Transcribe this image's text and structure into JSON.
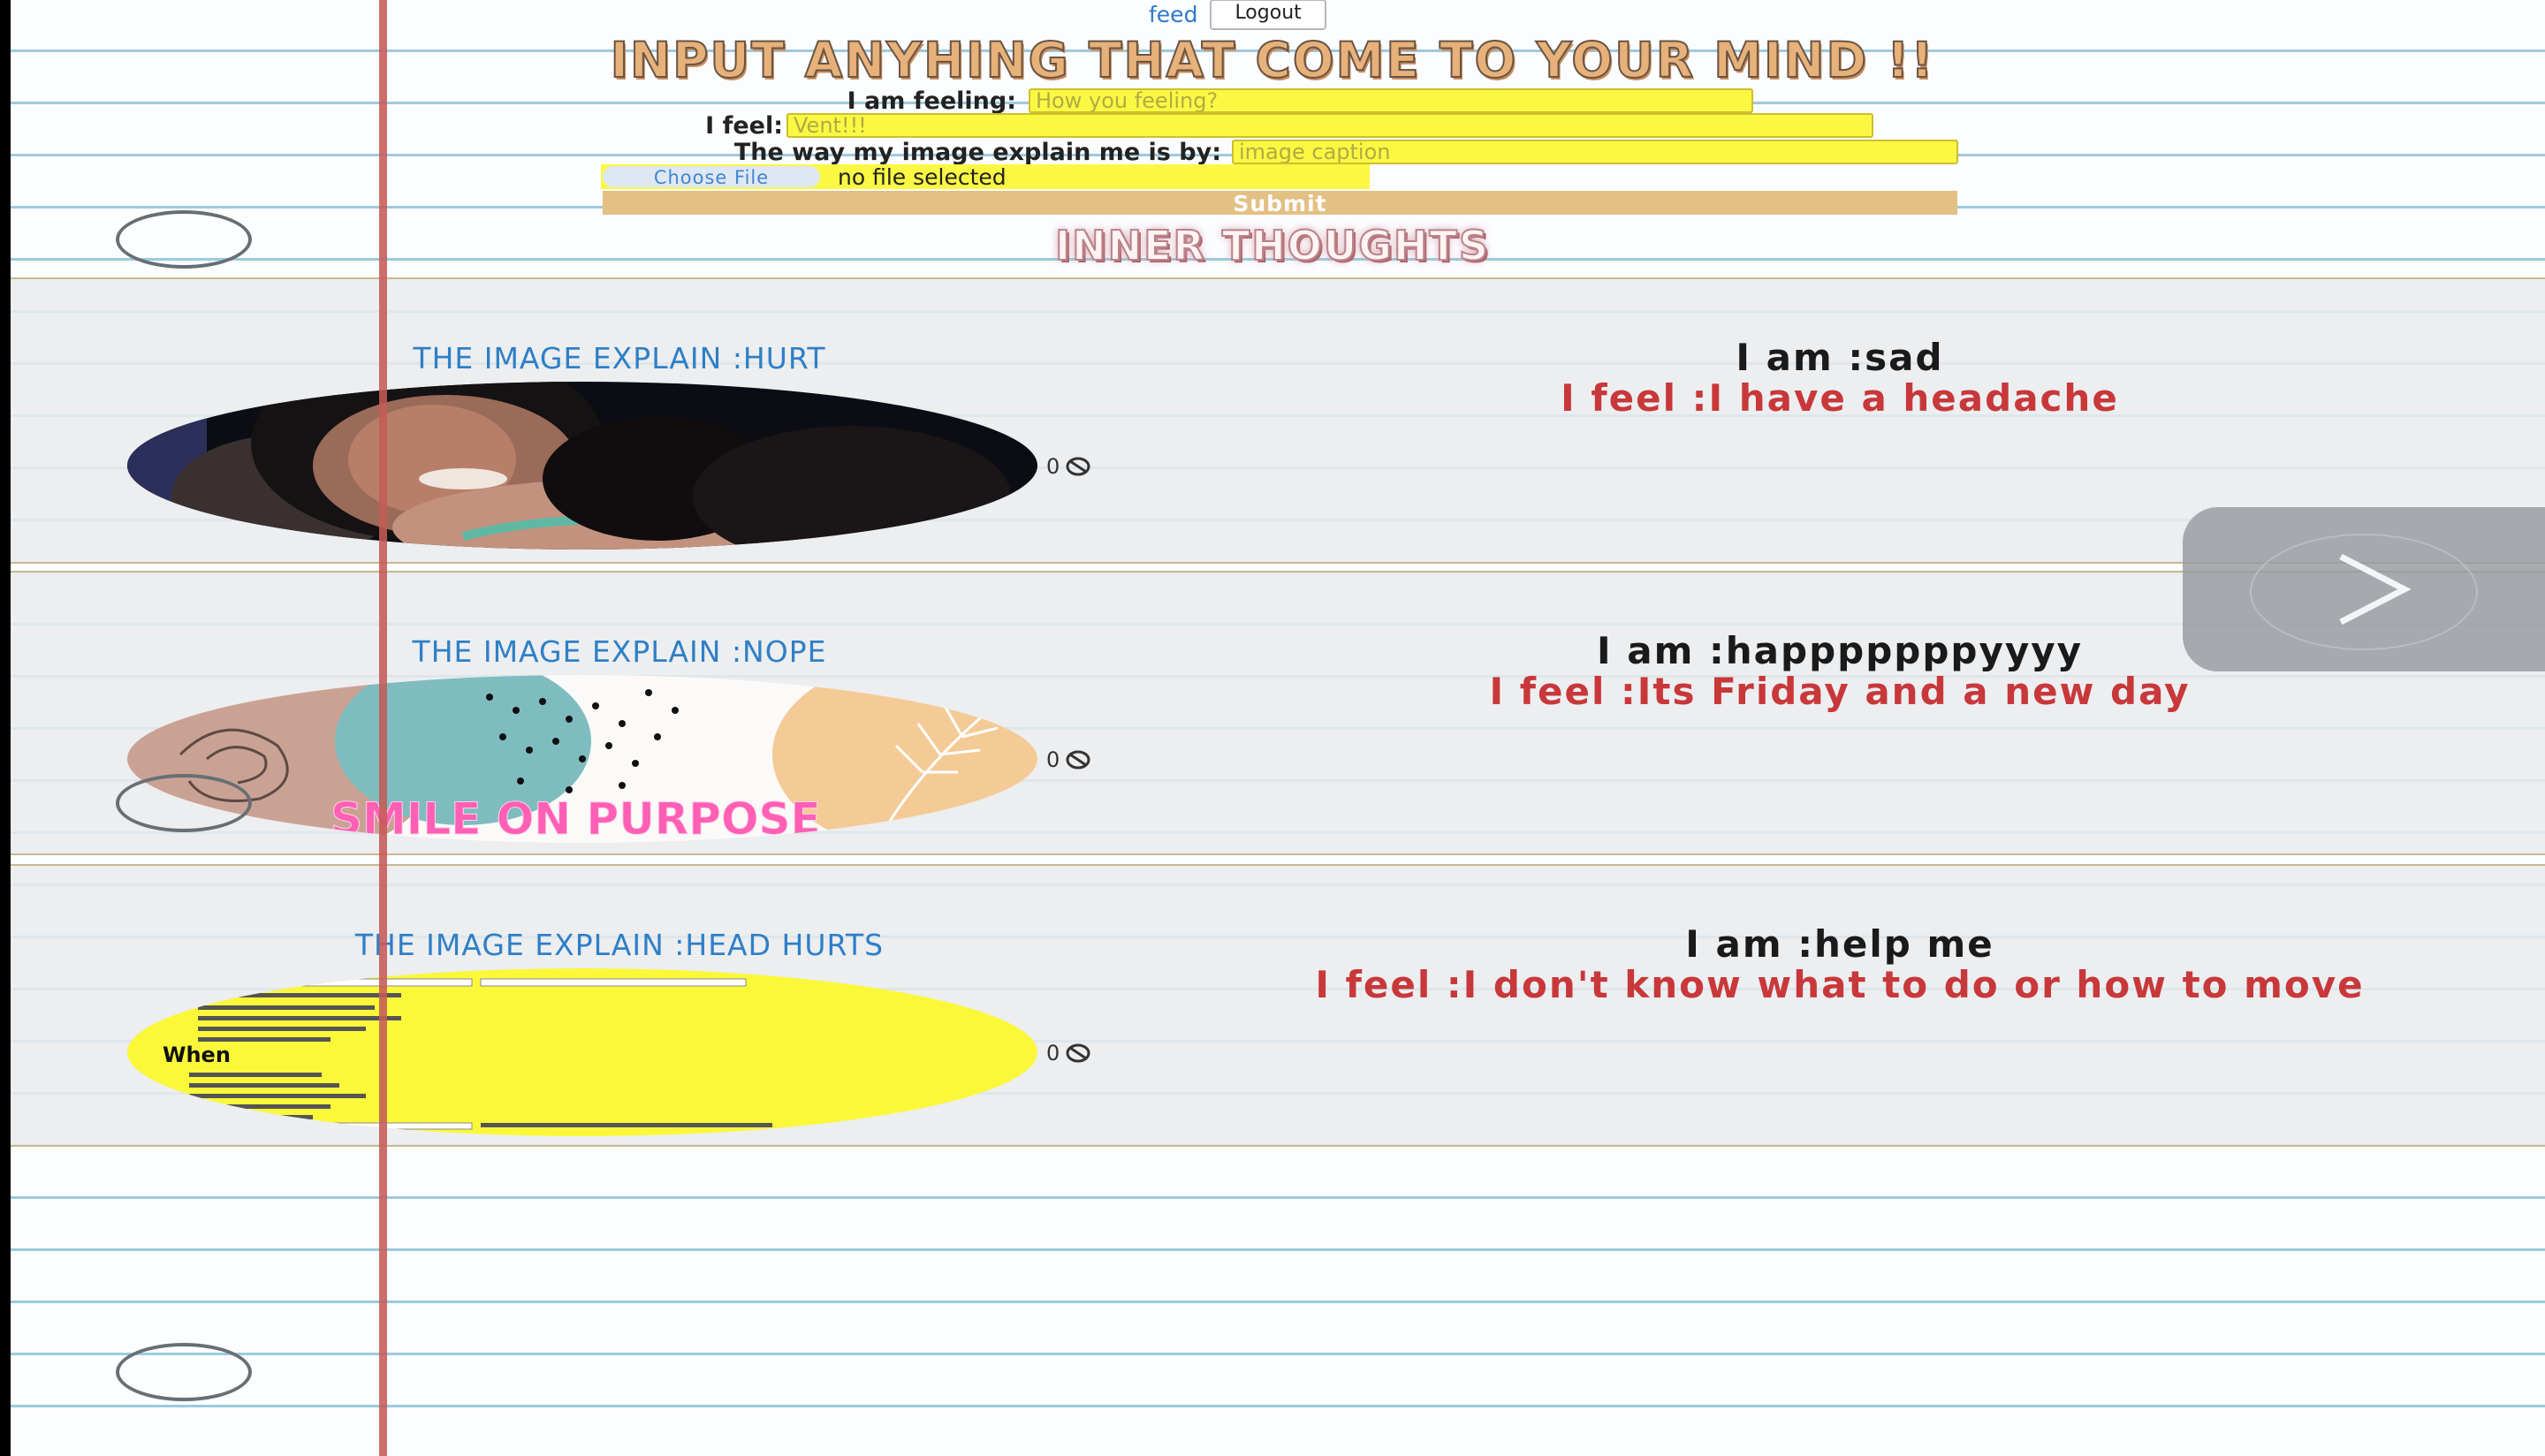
{
  "nav": {
    "feed_label": "feed",
    "logout_label": "Logout"
  },
  "heading": "INPUT ANYHING THAT COME TO YOUR MIND !!",
  "form": {
    "feeling_label": "I am feeling:",
    "feeling_placeholder": "How you feeling?",
    "feel_label": "I feel:",
    "feel_placeholder": "Vent!!!",
    "caption_label": "The way my image explain me is by:",
    "caption_placeholder": "image caption",
    "choose_file_label": "Choose File",
    "file_status": "no file selected",
    "submit_label": "Submit"
  },
  "section_title": "INNER THOUGHTS",
  "posts": [
    {
      "caption": "THE IMAGE EXPLAIN :HURT",
      "iam": "I am :sad",
      "ifeel": "I feel :I have a headache",
      "likes": "0"
    },
    {
      "caption": "THE IMAGE EXPLAIN :NOPE",
      "iam": "I am :happpppppyyyy",
      "ifeel": "I feel :Its Friday and a new day",
      "likes": "0",
      "image_text": "SMILE ON PURPOSE"
    },
    {
      "caption": "THE IMAGE EXPLAIN :HEAD HURTS",
      "iam": "I am :help me",
      "ifeel": "I feel :I don't know what to do or how to move",
      "likes": "0",
      "image_text": "When"
    }
  ],
  "icons": {
    "like": "block-icon",
    "next": "chevron-right-icon"
  },
  "colors": {
    "input_bg": "#fbf844",
    "submit_bg": "#e3c083",
    "caption": "#2f7fc6",
    "feel_text": "#c8383a",
    "margin_line": "#c45b57"
  }
}
